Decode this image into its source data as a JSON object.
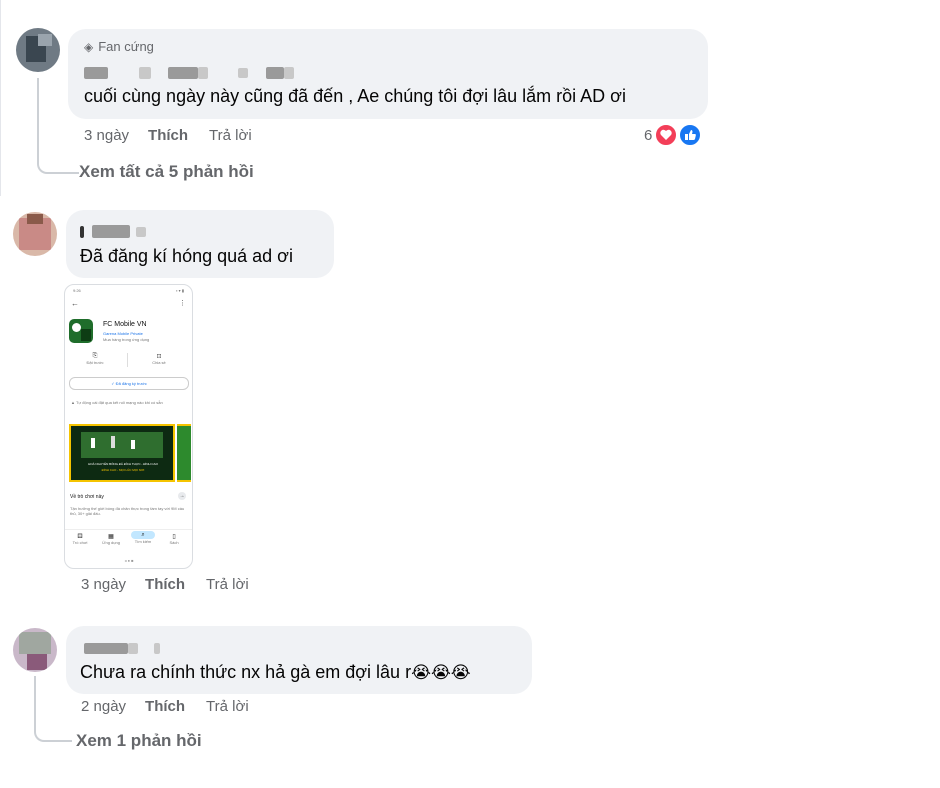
{
  "comments": [
    {
      "badge": "Fan cứng",
      "author_visible": "CM        FC",
      "text": "cuối cùng ngày này cũng đã đến , Ae chúng tôi đợi lâu lắm rồi AD ơi",
      "time": "3 ngày",
      "like": "Thích",
      "reply": "Trả lời",
      "reaction_count": "6",
      "replies": "Xem tất cả 5 phản hồi"
    },
    {
      "author_visible": "C",
      "text": "Đã đăng kí hóng quá ad ơi",
      "time": "3 ngày",
      "like": "Thích",
      "reply": "Trả lời",
      "attachment": {
        "status_time": "9:26",
        "app_name": "FC Mobile VN",
        "developer": "Garena Mobile Private",
        "subtitle": "Mua hàng trong ứng dụng",
        "action_1": "Đặt trước",
        "action_2": "Chia sẻ",
        "registered": "✓ Đã đăng ký trước",
        "notice": "Tự động cài đặt qua kết nối mạng nào khi có sẵn",
        "banner_line1": "HOÀ NGUYÊN BÓNG ĐÁ ĐÍCH THỰC - ĐỈNH CAO",
        "banner_line2": "ĐỈNH CAO - MỌI LÚC MỌI NƠI",
        "about": "Về trò chơi này",
        "about_desc": "Tận hưởng thế giới bóng đá chân thực trong tầm tay với 9M cầu thủ, 30+ giải đấu.",
        "nav": [
          "Trò chơi",
          "Ứng dụng",
          "Tìm kiếm",
          "Sách"
        ]
      }
    },
    {
      "author_visible": "H",
      "text": "Chưa ra chính thức nx hả gà em đợi lâu r",
      "emojis": "😭😭😭",
      "time": "2 ngày",
      "like": "Thích",
      "reply": "Trả lời",
      "replies": "Xem 1 phản hồi"
    }
  ],
  "colors": {
    "bubble": "#f0f2f5",
    "meta_text": "#65676b",
    "like_blue": "#1877f2",
    "love_red": "#f33e58"
  }
}
